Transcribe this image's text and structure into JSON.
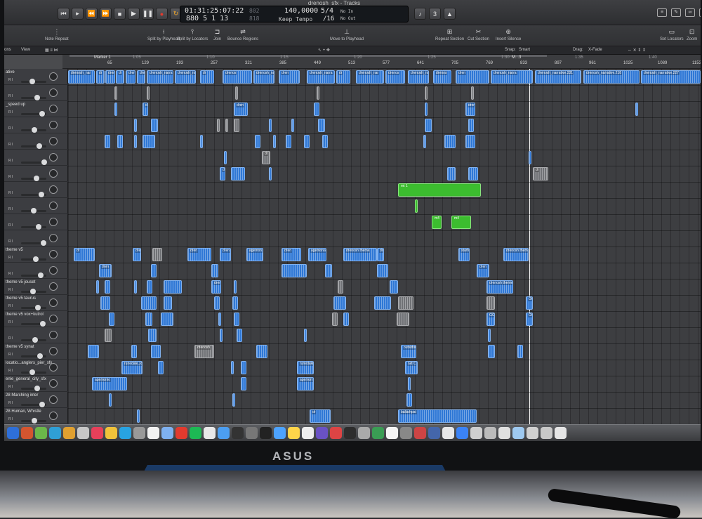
{
  "window": {
    "title": "drenosh_sfx - Tracks"
  },
  "lcd": {
    "time": "01:31:25:07:22",
    "bars": "880 5 1 13",
    "time_dim": "802",
    "bars_dim": "818",
    "tempo": "140,0000",
    "tempo_mode": "Keep Tempo",
    "signature": "5/4",
    "division": "/16",
    "in": "No In",
    "out": "No Out"
  },
  "toolbar": {
    "note_repeat": "Note Repeat",
    "split_playhead": "Split by Playhead",
    "split_locators": "Split by Locators",
    "join": "Join",
    "bounce": "Bounce Regions",
    "move_playhead": "Move to Playhead",
    "repeat_section": "Repeat Section",
    "cut_section": "Cut Section",
    "insert_silence": "Insert Silence",
    "set_locators": "Set Locators",
    "zoom": "Zoom"
  },
  "tracks_bar": {
    "functions": "ons",
    "view": "View",
    "snap_label": "Snap:",
    "snap_value": "Smart",
    "drag_label": "Drag:",
    "drag_value": "X-Fade"
  },
  "ruler": {
    "marker": "Marker 1",
    "ticks": [
      "65",
      "129",
      "193",
      "257",
      "321",
      "385",
      "449",
      "513",
      "577",
      "641",
      "705",
      "769",
      "833",
      "897",
      "961",
      "1025",
      "1089",
      "1153"
    ],
    "seconds": [
      "1:05",
      "1:10",
      "1:15",
      "1:20",
      "1:25",
      "1:30",
      "1:35",
      "1:40"
    ],
    "m_label": "M...3"
  },
  "tracks": [
    {
      "name": "ative"
    },
    {
      "name": ""
    },
    {
      "name": "_speed up"
    },
    {
      "name": ""
    },
    {
      "name": ""
    },
    {
      "name": ""
    },
    {
      "name": ""
    },
    {
      "name": ""
    },
    {
      "name": ""
    },
    {
      "name": ""
    },
    {
      "name": ""
    },
    {
      "name": "theme v5"
    },
    {
      "name": ""
    },
    {
      "name": "theme v5 jouset"
    },
    {
      "name": "theme v5 taurus"
    },
    {
      "name": "theme v5 vox+kutrol"
    },
    {
      "name": ""
    },
    {
      "name": "theme v5 synat"
    },
    {
      "name": "locatio...anglers_pier_sfx"
    },
    {
      "name": "enle_general_city_sfx"
    },
    {
      "name": "28 Marching inter"
    },
    {
      "name": "28 Human, Whistle"
    }
  ],
  "regions": {
    "r0": "drenosh_nar",
    "r1": "dr",
    "r2": "drenos",
    "r3": "dren",
    "r4": "drenosh_narra",
    "r5": "drenosh_nar",
    "r6": "drenos",
    "r7": "drenosh_narrative.331",
    "r8": "drenosh_narrative.218",
    "r9": "drenosh_narrative.227",
    "r10": "dren",
    "r11": "dr",
    "r12": "dr",
    "r13": "mt 1",
    "r14": "m4",
    "r15": "m4",
    "r16": "dr",
    "r17": "dreno",
    "r18": "agemon",
    "r19": "agemona",
    "r20": "drenosh theme",
    "r21": "dre",
    "r22": "starh",
    "r23": "drenosh theme",
    "r24": "dren",
    "r25": "drenosh theme",
    "r26": "drenosh",
    "r27": "runedale_lo",
    "r28": "agemonio",
    "r29": "runedale",
    "r30": "agemon",
    "r31": "outsidors",
    "r32": "Gtl C",
    "r33": "ballarhpat",
    "r34": "GO",
    "r35": "GO"
  },
  "colors": {
    "audio": "#2f78d6",
    "midi": "#3cbd2f",
    "muted": "#707276",
    "bezel": "#111214"
  },
  "monitor": {
    "brand": "ASUS"
  },
  "dock": {
    "icons": [
      "finder-icon",
      "launchpad-icon",
      "safari-icon",
      "mail-icon",
      "calendar-icon",
      "notes-icon",
      "music-icon",
      "logic-icon",
      "spotify-icon",
      "settings-icon",
      "chrome-icon",
      "trash-icon"
    ]
  }
}
